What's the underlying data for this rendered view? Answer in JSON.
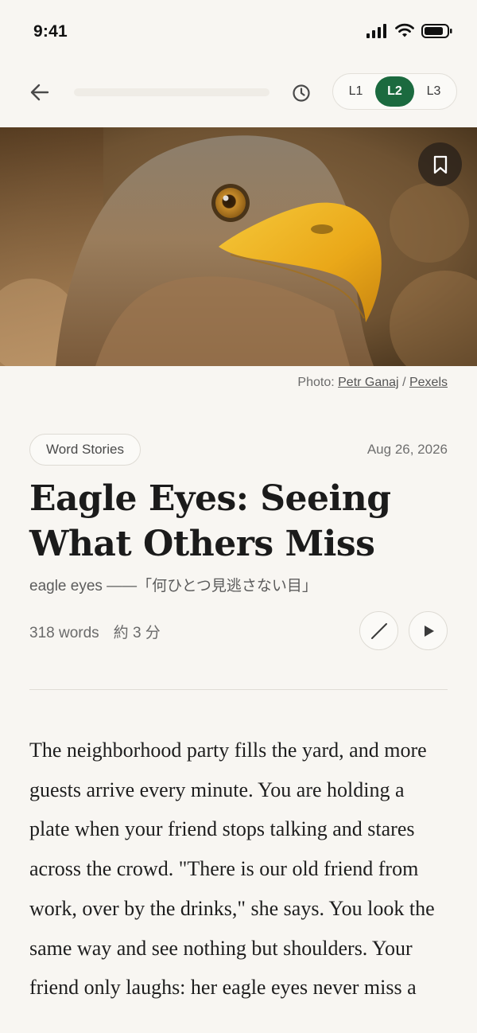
{
  "status_bar": {
    "time": "9:41",
    "icons": [
      "signal-icon",
      "wifi-icon",
      "battery-icon"
    ]
  },
  "toolbar": {
    "back_icon": "back-arrow-icon",
    "reading_progress": 0,
    "history_icon": "clock-icon",
    "levels": [
      "L1",
      "L2",
      "L3"
    ],
    "active_level": "L2",
    "accent_color": "#1b6a3f"
  },
  "hero": {
    "subject": "eagle head photo",
    "bookmark_icon": "bookmark-icon"
  },
  "photo_credit": {
    "prefix": "Photo:",
    "author": "Petr Ganaj",
    "separator": "/",
    "source": "Pexels"
  },
  "article": {
    "category": "Word Stories",
    "date": "Aug 26, 2026",
    "title": "Eagle Eyes: Seeing What Others Miss",
    "subtitle": "eagle eyes ——「何ひとつ見逃さない目」",
    "word_count": "318 words",
    "read_time": "約 3 分",
    "pen_icon": "pen-icon",
    "play_icon": "play-icon",
    "body": "The neighborhood party fills the yard, and more guests arrive every minute. You are holding a plate when your friend stops talking and stares across the crowd. \"There is our old friend from work, over by the drinks,\" she says. You look the same way and see nothing but shoulders. Your friend only laughs: her eagle eyes never miss a"
  }
}
